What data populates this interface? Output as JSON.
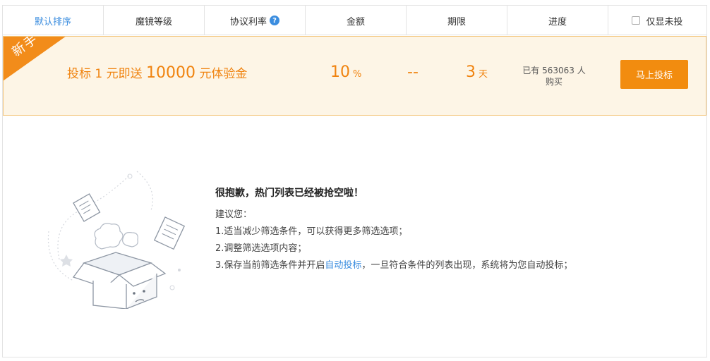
{
  "header": {
    "sort_default": "默认排序",
    "magic_level": "魔镜等级",
    "agreed_rate": "协议利率",
    "amount": "金额",
    "term": "期限",
    "progress": "进度",
    "only_uninvested": "仅显未投"
  },
  "newbie": {
    "badge": "新手",
    "promo_prefix": "投标 1 元即送",
    "promo_amount": "10000",
    "promo_suffix": "元体验金",
    "rate_value": "10",
    "rate_unit": "%",
    "amount_value": "--",
    "term_value": "3",
    "term_unit": "天",
    "progress_line1": "已有 563063 人",
    "progress_line2": "购买",
    "invest_button": "马上投标"
  },
  "empty": {
    "title": "很抱歉，热门列表已经被抢空啦！",
    "suggest": "建议您：",
    "item1": "1.适当减少筛选条件，可以获得更多筛选选项；",
    "item2": "2.调整筛选选项内容；",
    "item3_prefix": "3.保存当前筛选条件并开启",
    "item3_link": "自动投标",
    "item3_suffix": "，一旦符合条件的列表出现，系统将为您自动投标；"
  },
  "colors": {
    "accent_orange": "#f28c0f",
    "link_blue": "#3b8ddf",
    "row_bg": "#fdf5e6"
  }
}
